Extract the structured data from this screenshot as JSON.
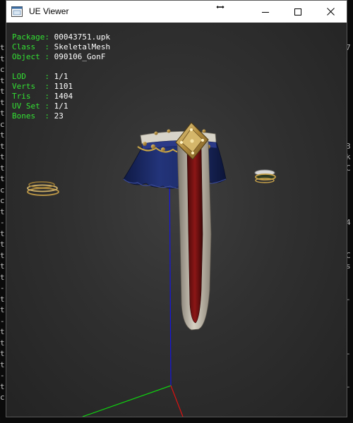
{
  "window": {
    "title": "UE Viewer"
  },
  "info": {
    "rows_top": [
      {
        "key": "Package",
        "sep": ": ",
        "value": "00043751.upk"
      },
      {
        "key": "Class  ",
        "sep": ": ",
        "value": "SkeletalMesh"
      },
      {
        "key": "Object ",
        "sep": ": ",
        "value": "090106_GonF"
      }
    ],
    "rows_mesh": [
      {
        "key": "LOD    ",
        "sep": ": ",
        "value": "1/1"
      },
      {
        "key": "Verts  ",
        "sep": ": ",
        "value": "1101"
      },
      {
        "key": "Tris   ",
        "sep": ": ",
        "value": "1404"
      },
      {
        "key": "UV Set ",
        "sep": ": ",
        "value": "1/1"
      },
      {
        "key": "Bones  ",
        "sep": ": ",
        "value": "23"
      }
    ]
  },
  "background_console": {
    "left_chars": [
      "t",
      "t",
      "c",
      "t",
      "t",
      "t",
      "t",
      "c",
      "t",
      "t",
      "t",
      "t",
      "t",
      "c",
      "c",
      "t",
      "-",
      "t",
      "t",
      "t",
      "t",
      "t",
      "-",
      "t",
      "t",
      "-",
      "t",
      "t",
      "t",
      "t",
      "-",
      "t",
      "c"
    ],
    "right_chars": [
      "7",
      "",
      "",
      "",
      "",
      "",
      "",
      "",
      "",
      "3",
      "k",
      "C",
      "",
      "",
      "",
      "",
      "4",
      "",
      "",
      "C",
      "s",
      "",
      "",
      "-",
      "",
      "",
      "",
      "",
      "-",
      "",
      "",
      "-",
      ""
    ]
  },
  "colors": {
    "info_key": "#33e033",
    "info_value": "#ffffff",
    "axis_x": "#e01010",
    "axis_y": "#10d010",
    "axis_z": "#1515e0"
  }
}
